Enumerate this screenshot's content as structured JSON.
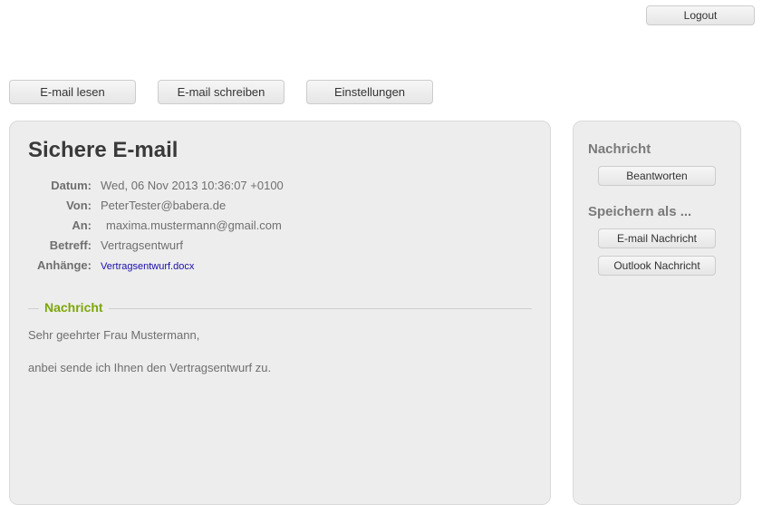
{
  "topbar": {
    "logout_label": "Logout"
  },
  "nav": {
    "read_label": "E-mail lesen",
    "write_label": "E-mail schreiben",
    "settings_label": "Einstellungen"
  },
  "main": {
    "title": "Sichere E-mail",
    "meta": {
      "date_label": "Datum:",
      "date_value": "Wed, 06 Nov 2013 10:36:07 +0100",
      "from_label": "Von:",
      "from_value": "PeterTester@babera.de",
      "to_label": "An:",
      "to_value": "maxima.mustermann@gmail.com",
      "subject_label": "Betreff:",
      "subject_value": "Vertragsentwurf",
      "attachments_label": "Anhänge:",
      "attachment_name": "Vertragsentwurf.docx"
    },
    "section_title": "Nachricht",
    "body": {
      "line1": "Sehr geehrter Frau Mustermann,",
      "line2": "anbei sende ich Ihnen den Vertragsentwurf zu."
    }
  },
  "sidebar": {
    "message_heading": "Nachricht",
    "reply_label": "Beantworten",
    "saveas_heading": "Speichern als ...",
    "save_email_label": "E-mail Nachricht",
    "save_outlook_label": "Outlook Nachricht"
  }
}
